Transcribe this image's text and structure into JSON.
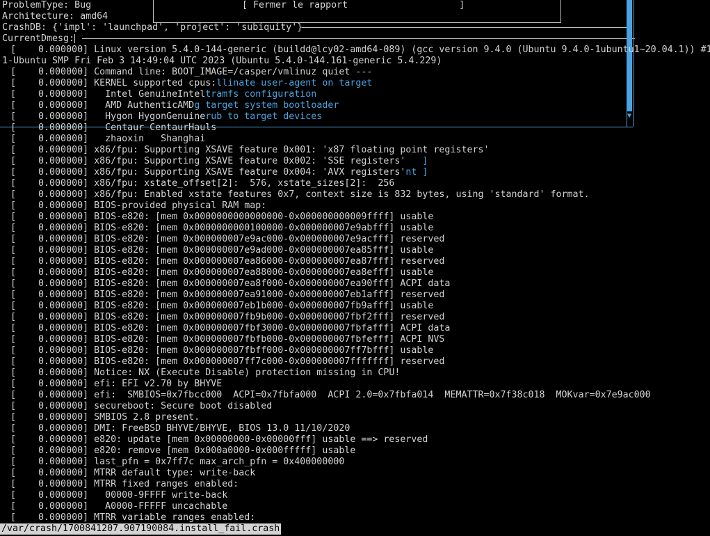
{
  "header": {
    "problem_type": "ProblemType: Bug",
    "architecture": "Architecture: amd64",
    "crashdb": "CrashDB: {'impl': 'launchpad', 'project': 'subiquity'}",
    "current_dmesg": "CurrentDmesg:",
    "close_report_button": "[ Fermer le rapport                    ]"
  },
  "kernel_version_line_1": "[    0.000000] Linux version 5.4.0-144-generic (buildd@lcy02-amd64-089) (gcc version 9.4.0 (Ubuntu 9.4.0-1ubuntu1~20.04.1)) #16",
  "kernel_version_line_2": "1-Ubuntu SMP Fri Feb 3 14:49:04 UTC 2023 (Ubuntu 5.4.0-144.161-generic 5.4.229)",
  "dmesg": [
    {
      "ts": "0.000000]",
      "msg": "Command line: BOOT_IMAGE=/casper/vmlinuz quiet ---",
      "overlay": ""
    },
    {
      "ts": "0.000000]",
      "msg": "KERNEL supported cpus:",
      "overlay": "llinate user-agent on target"
    },
    {
      "ts": "0.000000]",
      "msg": "  Intel GenuineIntel",
      "overlay": "tramfs configuration"
    },
    {
      "ts": "0.000000]",
      "msg": "  AMD AuthenticAMD",
      "overlay": "g target system bootloader"
    },
    {
      "ts": "0.000000]",
      "msg": "  Hygon HygonGenuine",
      "overlay": "rub to target devices"
    },
    {
      "ts": "0.000000]",
      "msg": "  Centaur CentaurHauls",
      "overlay": ""
    },
    {
      "ts": "0.000000]",
      "msg": "  zhaoxin   Shanghai",
      "overlay": ""
    },
    {
      "ts": "0.000000]",
      "msg": "x86/fpu: Supporting XSAVE feature 0x001: 'x87 floating point registers'",
      "overlay": ""
    },
    {
      "ts": "0.000000]",
      "msg": "x86/fpu: Supporting XSAVE feature 0x002: 'SSE registers'   ",
      "overlay": "]"
    },
    {
      "ts": "0.000000]",
      "msg": "x86/fpu: Supporting XSAVE feature 0x004: 'AVX registers'",
      "overlay": "nt ]"
    },
    {
      "ts": "0.000000]",
      "msg": "x86/fpu: xstate_offset[2]:  576, xstate_sizes[2]:  256",
      "overlay": ""
    },
    {
      "ts": "0.000000]",
      "msg": "x86/fpu: Enabled xstate features 0x7, context size is 832 bytes, using 'standard' format.",
      "overlay": ""
    },
    {
      "ts": "0.000000]",
      "msg": "BIOS-provided physical RAM map:",
      "overlay": ""
    },
    {
      "ts": "0.000000]",
      "msg": "BIOS-e820: [mem 0x0000000000000000-0x000000000009ffff] usable",
      "overlay": ""
    },
    {
      "ts": "0.000000]",
      "msg": "BIOS-e820: [mem 0x0000000000100000-0x000000007e9abfff] usable",
      "overlay": ""
    },
    {
      "ts": "0.000000]",
      "msg": "BIOS-e820: [mem 0x000000007e9ac000-0x000000007e9acfff] reserved",
      "overlay": ""
    },
    {
      "ts": "0.000000]",
      "msg": "BIOS-e820: [mem 0x000000007e9ad000-0x000000007ea85fff] usable",
      "overlay": ""
    },
    {
      "ts": "0.000000]",
      "msg": "BIOS-e820: [mem 0x000000007ea86000-0x000000007ea87fff] reserved",
      "overlay": ""
    },
    {
      "ts": "0.000000]",
      "msg": "BIOS-e820: [mem 0x000000007ea88000-0x000000007ea8efff] usable",
      "overlay": ""
    },
    {
      "ts": "0.000000]",
      "msg": "BIOS-e820: [mem 0x000000007ea8f000-0x000000007ea90fff] ACPI data",
      "overlay": ""
    },
    {
      "ts": "0.000000]",
      "msg": "BIOS-e820: [mem 0x000000007ea91000-0x000000007eb1afff] reserved",
      "overlay": ""
    },
    {
      "ts": "0.000000]",
      "msg": "BIOS-e820: [mem 0x000000007eb1b000-0x000000007fb9afff] usable",
      "overlay": ""
    },
    {
      "ts": "0.000000]",
      "msg": "BIOS-e820: [mem 0x000000007fb9b000-0x000000007fbf2fff] reserved",
      "overlay": ""
    },
    {
      "ts": "0.000000]",
      "msg": "BIOS-e820: [mem 0x000000007fbf3000-0x000000007fbfafff] ACPI data",
      "overlay": ""
    },
    {
      "ts": "0.000000]",
      "msg": "BIOS-e820: [mem 0x000000007fbfb000-0x000000007fbfefff] ACPI NVS",
      "overlay": ""
    },
    {
      "ts": "0.000000]",
      "msg": "BIOS-e820: [mem 0x000000007fbff000-0x000000007ff7bfff] usable",
      "overlay": ""
    },
    {
      "ts": "0.000000]",
      "msg": "BIOS-e820: [mem 0x000000007ff7c000-0x000000007fffffff] reserved",
      "overlay": ""
    },
    {
      "ts": "0.000000]",
      "msg": "Notice: NX (Execute Disable) protection missing in CPU!",
      "overlay": ""
    },
    {
      "ts": "0.000000]",
      "msg": "efi: EFI v2.70 by BHYVE",
      "overlay": ""
    },
    {
      "ts": "0.000000]",
      "msg": "efi:  SMBIOS=0x7fbcc000  ACPI=0x7fbfa000  ACPI 2.0=0x7fbfa014  MEMATTR=0x7f38c018  MOKvar=0x7e9ac000",
      "overlay": ""
    },
    {
      "ts": "0.000000]",
      "msg": "secureboot: Secure boot disabled",
      "overlay": ""
    },
    {
      "ts": "0.000000]",
      "msg": "SMBIOS 2.8 present.",
      "overlay": ""
    },
    {
      "ts": "0.000000]",
      "msg": "DMI: FreeBSD BHYVE/BHYVE, BIOS 13.0 11/10/2020",
      "overlay": ""
    },
    {
      "ts": "0.000000]",
      "msg": "e820: update [mem 0x00000000-0x00000fff] usable ==> reserved",
      "overlay": ""
    },
    {
      "ts": "0.000000]",
      "msg": "e820: remove [mem 0x000a0000-0x000fffff] usable",
      "overlay": ""
    },
    {
      "ts": "0.000000]",
      "msg": "last_pfn = 0x7ff7c max_arch_pfn = 0x400000000",
      "overlay": ""
    },
    {
      "ts": "0.000000]",
      "msg": "MTRR default type: write-back",
      "overlay": ""
    },
    {
      "ts": "0.000000]",
      "msg": "MTRR fixed ranges enabled:",
      "overlay": ""
    },
    {
      "ts": "0.000000]",
      "msg": "  00000-9FFFF write-back",
      "overlay": ""
    },
    {
      "ts": "0.000000]",
      "msg": "  A0000-FFFFF uncachable",
      "overlay": ""
    },
    {
      "ts": "0.000000]",
      "msg": "MTRR variable ranges enabled:",
      "overlay": ""
    }
  ],
  "status_bar": {
    "file_path": "/var/crash/1700841207.907190084.install_fail.crash"
  },
  "colors": {
    "background": "#000000",
    "text": "#d3d3d3",
    "accent_blue": "#4aa3df",
    "status_bg": "#d3d3d3"
  }
}
